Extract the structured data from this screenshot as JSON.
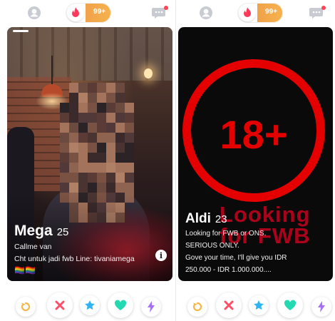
{
  "colors": {
    "brand_red": "#ff4458",
    "rewind": "#f5b748",
    "nope": "#fd5068",
    "superlike": "#2db4f2",
    "like": "#22d9b1",
    "boost": "#a96ff7",
    "warning_red": "#e40000"
  },
  "left": {
    "topbar": {
      "likes_count": "99+",
      "icons": [
        "profile-icon",
        "flame-icon",
        "chat-icon"
      ]
    },
    "card": {
      "name": "Mega",
      "age": "25",
      "bio_line1": "Callme van",
      "bio_line2": "Cht untuk jadi fwb Line: tivaniamega",
      "emoji": "🏳‍🌈🏳‍🌈",
      "info_label": "i"
    },
    "actions": [
      "rewind-icon",
      "nope-icon",
      "superlike-icon",
      "like-icon",
      "boost-icon"
    ]
  },
  "right": {
    "topbar": {
      "likes_count": "99+",
      "icons": [
        "profile-icon",
        "flame-icon",
        "chat-icon"
      ]
    },
    "card": {
      "badge": "18+",
      "overlay_text_line1": "Looking",
      "overlay_text_line2": "for FWB",
      "name": "Aldi",
      "age": "23",
      "bio_line1": "Looking for FWB or ONS.",
      "bio_line2": "SERIOUS ONLY.",
      "bio_line3": "Gove your time, I'll give you IDR",
      "bio_line4": "250.000 - IDR 1.000.000...."
    },
    "actions": [
      "rewind-icon",
      "nope-icon",
      "superlike-icon",
      "like-icon",
      "boost-icon"
    ]
  }
}
